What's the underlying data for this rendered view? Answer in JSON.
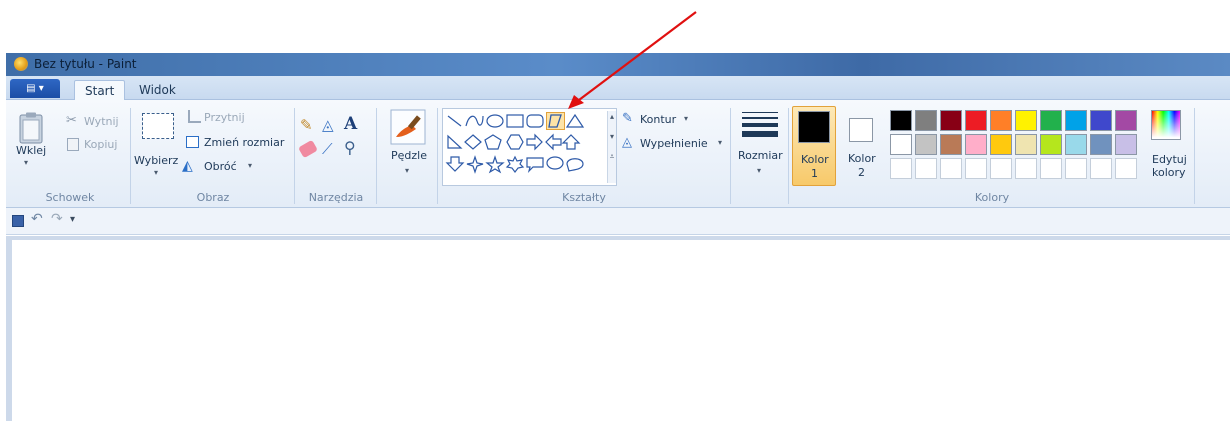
{
  "window": {
    "title": "Bez tytułu - Paint"
  },
  "tabs": [
    "Start",
    "Widok"
  ],
  "file_menu": {
    "label": "▤ ▾"
  },
  "groups": {
    "schowek": {
      "label": "Schowek",
      "wklej": "Wklej",
      "wytnij": "Wytnij",
      "kopiuj": "Kopiuj"
    },
    "obraz": {
      "label": "Obraz",
      "wybierz": "Wybierz",
      "przytnij": "Przytnij",
      "zmien_rozmiar": "Zmień rozmiar",
      "obroc": "Obróć"
    },
    "narzedzia": {
      "label": "Narzędzia"
    },
    "pedzle": {
      "label": "Pędzle"
    },
    "ksztalty": {
      "label": "Kształty",
      "kontur": "Kontur",
      "wypelnienie": "Wypełnienie"
    },
    "rozmiar": {
      "label": "Rozmiar"
    },
    "kolory": {
      "label": "Kolory",
      "kolor1": "Kolor",
      "kolor1_num": "1",
      "kolor2": "Kolor",
      "kolor2_num": "2",
      "edytuj": "Edytuj",
      "edytuj2": "kolory"
    }
  },
  "palette": {
    "row1": [
      "#000000",
      "#7f7f7f",
      "#880015",
      "#ed1c24",
      "#ff7f27",
      "#fff200",
      "#22b14c",
      "#00a2e8",
      "#3f48cc",
      "#a349a4"
    ],
    "row2": [
      "#ffffff",
      "#c3c3c3",
      "#b97a57",
      "#ffaec9",
      "#ffc90e",
      "#efe4b0",
      "#b5e61d",
      "#99d9ea",
      "#7092be",
      "#c8bfe7"
    ],
    "color1": "#000000",
    "color2": "#ffffff"
  },
  "annotation": {
    "arrow_color": "#e01010"
  }
}
